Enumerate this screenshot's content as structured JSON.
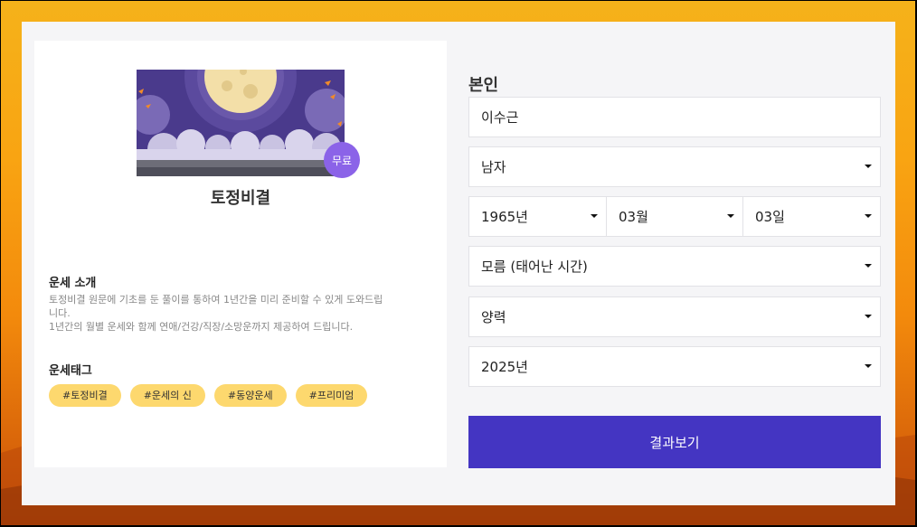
{
  "product": {
    "title": "토정비결",
    "badge": "무료"
  },
  "intro": {
    "heading": "운세 소개",
    "lines": [
      "토정비결 원문에 기초를 둔 풀이를 통하여 1년간을 미리 준비할 수 있게 도와드립",
      "니다.",
      "1년간의 월별 운세와 함께 연애/건강/직장/소망운까지 제공하여 드립니다."
    ]
  },
  "tags": {
    "heading": "운세태그",
    "items": [
      "#토정비결",
      "#운세의 신",
      "#동양운세",
      "#프리미엄"
    ]
  },
  "form": {
    "section_title": "본인",
    "name_value": "이수근",
    "gender": "남자",
    "birth_year": "1965년",
    "birth_month": "03월",
    "birth_day": "03일",
    "birth_time": "모름 (태어난 시간)",
    "calendar": "양력",
    "target_year": "2025년",
    "submit_label": "결과보기"
  },
  "colors": {
    "accent": "#4435c2",
    "tag_bg": "#fdd86e",
    "badge_bg": "#8b63e8"
  }
}
